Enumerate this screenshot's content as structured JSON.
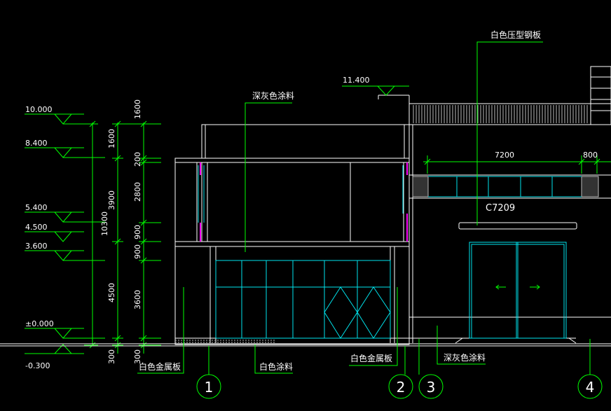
{
  "colors": {
    "background": "#000000",
    "outline": "#ffffff",
    "dimension": "#00ff00",
    "glazing": "#00e5ee",
    "frame_accent": "#ff00ff",
    "hatch": "#bbbbbb"
  },
  "elevation_marks": {
    "top": "10.000",
    "roof": "8.400",
    "upper_sill": "5.400",
    "lintel": "4.500",
    "floor2": "3.600",
    "ground": "±0.000",
    "grade": "-0.300",
    "parapet": "11.400"
  },
  "dimensions": {
    "total": "10300",
    "tier1": [
      "1600",
      "3900",
      "4500",
      "300"
    ],
    "tier2": [
      "1600",
      "200",
      "2800",
      "900",
      "900",
      "3600",
      "300"
    ],
    "span_a": "7200",
    "span_b": "800"
  },
  "labels": {
    "roof_panel": "白色压型钢板",
    "upper_paint": "深灰色涂料",
    "metal_panel_left": "白色金属板",
    "white_paint": "白色涂料",
    "metal_panel_right": "白色金属板",
    "lower_paint": "深灰色涂料",
    "window_code": "C7209"
  },
  "axis_bubbles": [
    "1",
    "2",
    "3",
    "4"
  ]
}
